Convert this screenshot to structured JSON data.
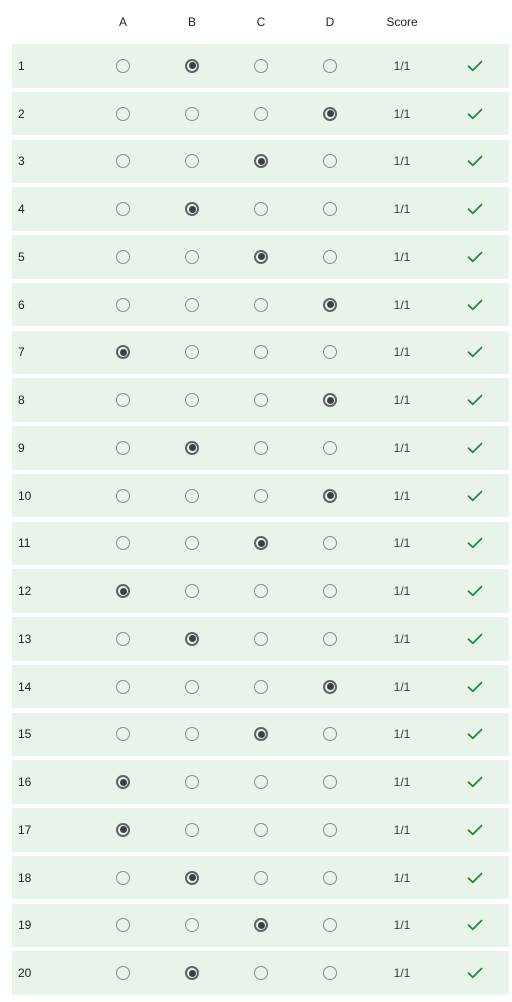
{
  "columns": {
    "a": "A",
    "b": "B",
    "c": "C",
    "d": "D",
    "score": "Score"
  },
  "options": [
    "A",
    "B",
    "C",
    "D"
  ],
  "colors": {
    "row_background": "#e8f3e9",
    "check": "#1e8e3e",
    "radio_unselected": "#8a8d91",
    "radio_selected": "#3c4043"
  },
  "rows": [
    {
      "label": "1",
      "selected": "B",
      "score": "1/1",
      "correct": true
    },
    {
      "label": "2",
      "selected": "D",
      "score": "1/1",
      "correct": true
    },
    {
      "label": "3",
      "selected": "C",
      "score": "1/1",
      "correct": true
    },
    {
      "label": "4",
      "selected": "B",
      "score": "1/1",
      "correct": true
    },
    {
      "label": "5",
      "selected": "C",
      "score": "1/1",
      "correct": true
    },
    {
      "label": "6",
      "selected": "D",
      "score": "1/1",
      "correct": true
    },
    {
      "label": "7",
      "selected": "A",
      "score": "1/1",
      "correct": true
    },
    {
      "label": "8",
      "selected": "D",
      "score": "1/1",
      "correct": true
    },
    {
      "label": "9",
      "selected": "B",
      "score": "1/1",
      "correct": true
    },
    {
      "label": "10",
      "selected": "D",
      "score": "1/1",
      "correct": true
    },
    {
      "label": "11",
      "selected": "C",
      "score": "1/1",
      "correct": true
    },
    {
      "label": "12",
      "selected": "A",
      "score": "1/1",
      "correct": true
    },
    {
      "label": "13",
      "selected": "B",
      "score": "1/1",
      "correct": true
    },
    {
      "label": "14",
      "selected": "D",
      "score": "1/1",
      "correct": true
    },
    {
      "label": "15",
      "selected": "C",
      "score": "1/1",
      "correct": true
    },
    {
      "label": "16",
      "selected": "A",
      "score": "1/1",
      "correct": true
    },
    {
      "label": "17",
      "selected": "A",
      "score": "1/1",
      "correct": true
    },
    {
      "label": "18",
      "selected": "B",
      "score": "1/1",
      "correct": true
    },
    {
      "label": "19",
      "selected": "C",
      "score": "1/1",
      "correct": true
    },
    {
      "label": "20",
      "selected": "B",
      "score": "1/1",
      "correct": true
    }
  ]
}
